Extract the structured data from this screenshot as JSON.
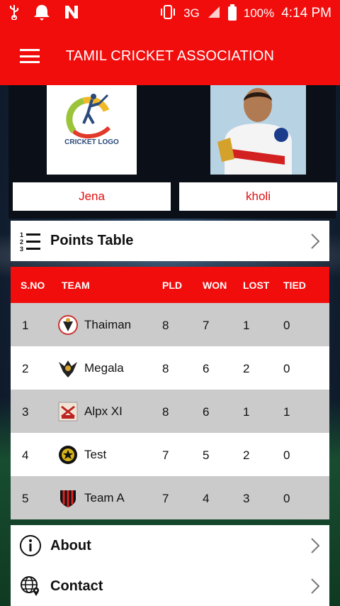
{
  "status_bar": {
    "network": "3G",
    "battery": "100%",
    "time": "4:14 PM"
  },
  "app_bar": {
    "title": "TAMIL CRICKET ASSOCIATION"
  },
  "players": [
    {
      "name": "Jena",
      "image_caption": "CRICKET LOGO"
    },
    {
      "name": "kholi",
      "image_caption": ""
    }
  ],
  "points_table": {
    "label": "Points Table",
    "headers": {
      "sno": "S.NO",
      "team": "TEAM",
      "pld": "PLD",
      "won": "WON",
      "lost": "LOST",
      "tied": "TIED"
    },
    "rows": [
      {
        "sno": "1",
        "team": "Thaiman",
        "pld": "8",
        "won": "7",
        "lost": "1",
        "tied": "0"
      },
      {
        "sno": "2",
        "team": "Megala",
        "pld": "8",
        "won": "6",
        "lost": "2",
        "tied": "0"
      },
      {
        "sno": "3",
        "team": "Alpx XI",
        "pld": "8",
        "won": "6",
        "lost": "1",
        "tied": "1"
      },
      {
        "sno": "4",
        "team": "Test",
        "pld": "7",
        "won": "5",
        "lost": "2",
        "tied": "0"
      },
      {
        "sno": "5",
        "team": "Team A",
        "pld": "7",
        "won": "4",
        "lost": "3",
        "tied": "0"
      }
    ]
  },
  "menu": {
    "about_label": "About",
    "contact_label": "Contact"
  },
  "colors": {
    "primary_red": "#f20d0d",
    "row_shade": "#cbcbcb"
  }
}
